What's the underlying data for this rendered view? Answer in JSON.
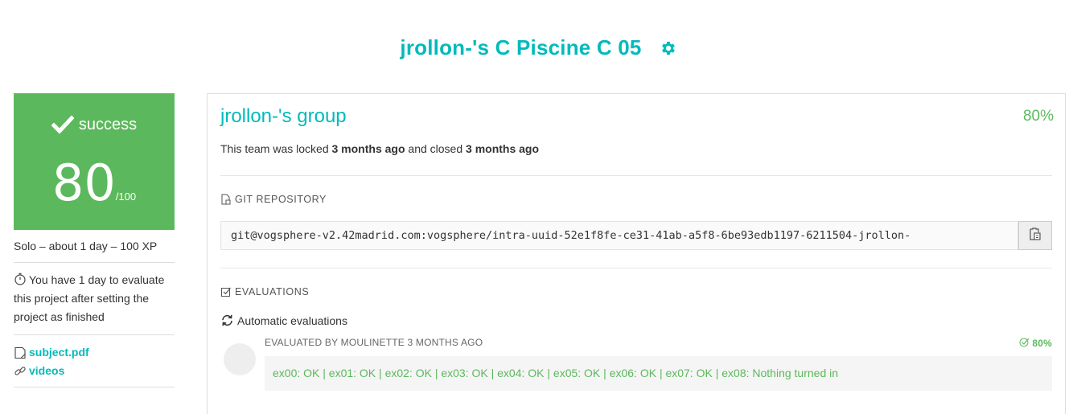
{
  "header": {
    "title": "jrollon-'s C Piscine C 05"
  },
  "score_card": {
    "status": "success",
    "score": "80",
    "max": "/100"
  },
  "sidebar": {
    "meta": "Solo – about 1 day – 100 XP",
    "eval_note": "You have 1 day to evaluate this project after setting the project as finished",
    "links": [
      {
        "label": "subject.pdf",
        "icon": "document-icon"
      },
      {
        "label": "videos",
        "icon": "link-icon"
      }
    ]
  },
  "group": {
    "name": "jrollon-'s group",
    "percent": "80%",
    "locked_prefix": "This team was locked",
    "locked_time": "3 months ago",
    "closed_prefix": "and closed",
    "closed_time": "3 months ago"
  },
  "git": {
    "label": "GIT REPOSITORY",
    "url": "git@vogsphere-v2.42madrid.com:vogsphere/intra-uuid-52e1f8fe-ce31-41ab-a5f8-6be93edb1197-6211504-jrollon-"
  },
  "evaluations": {
    "label": "EVALUATIONS",
    "auto_label": "Automatic evaluations",
    "items": [
      {
        "evaluator": "EVALUATED BY MOULINETTE 3 MONTHS AGO",
        "score": "80%",
        "result": "ex00: OK | ex01: OK | ex02: OK | ex03: OK | ex04: OK | ex05: OK | ex06: OK | ex07: OK | ex08: Nothing turned in"
      }
    ]
  },
  "colors": {
    "accent": "#00babc",
    "success": "#5cb85c"
  }
}
